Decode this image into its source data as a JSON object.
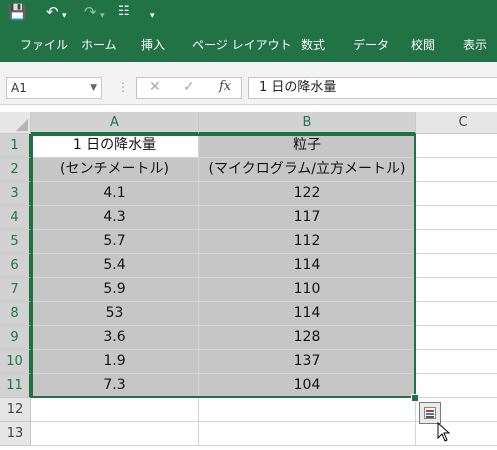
{
  "ribbon_tabs": [
    "ファイル",
    "ホーム",
    "挿入",
    "ページ レイアウト",
    "数式",
    "データ",
    "校閲",
    "表示"
  ],
  "formula_bar": {
    "name_box": "A1",
    "formula": "1 日の降水量",
    "fx": "fx"
  },
  "columns": [
    "A",
    "B",
    "C"
  ],
  "rows": [
    "1",
    "2",
    "3",
    "4",
    "5",
    "6",
    "7",
    "8",
    "9",
    "10",
    "11",
    "12",
    "13"
  ],
  "table": {
    "header1": [
      "1 日の降水量",
      "粒子"
    ],
    "header2": [
      "(センチメートル)",
      "(マイクログラム/立方メートル)"
    ],
    "data": [
      [
        "4.1",
        "122"
      ],
      [
        "4.3",
        "117"
      ],
      [
        "5.7",
        "112"
      ],
      [
        "5.4",
        "114"
      ],
      [
        "5.9",
        "110"
      ],
      [
        "53",
        "114"
      ],
      [
        "3.6",
        "128"
      ],
      [
        "1.9",
        "137"
      ],
      [
        "7.3",
        "104"
      ]
    ]
  },
  "colors": {
    "accent": "#217346",
    "selection_fill": "#c6c6c6"
  }
}
